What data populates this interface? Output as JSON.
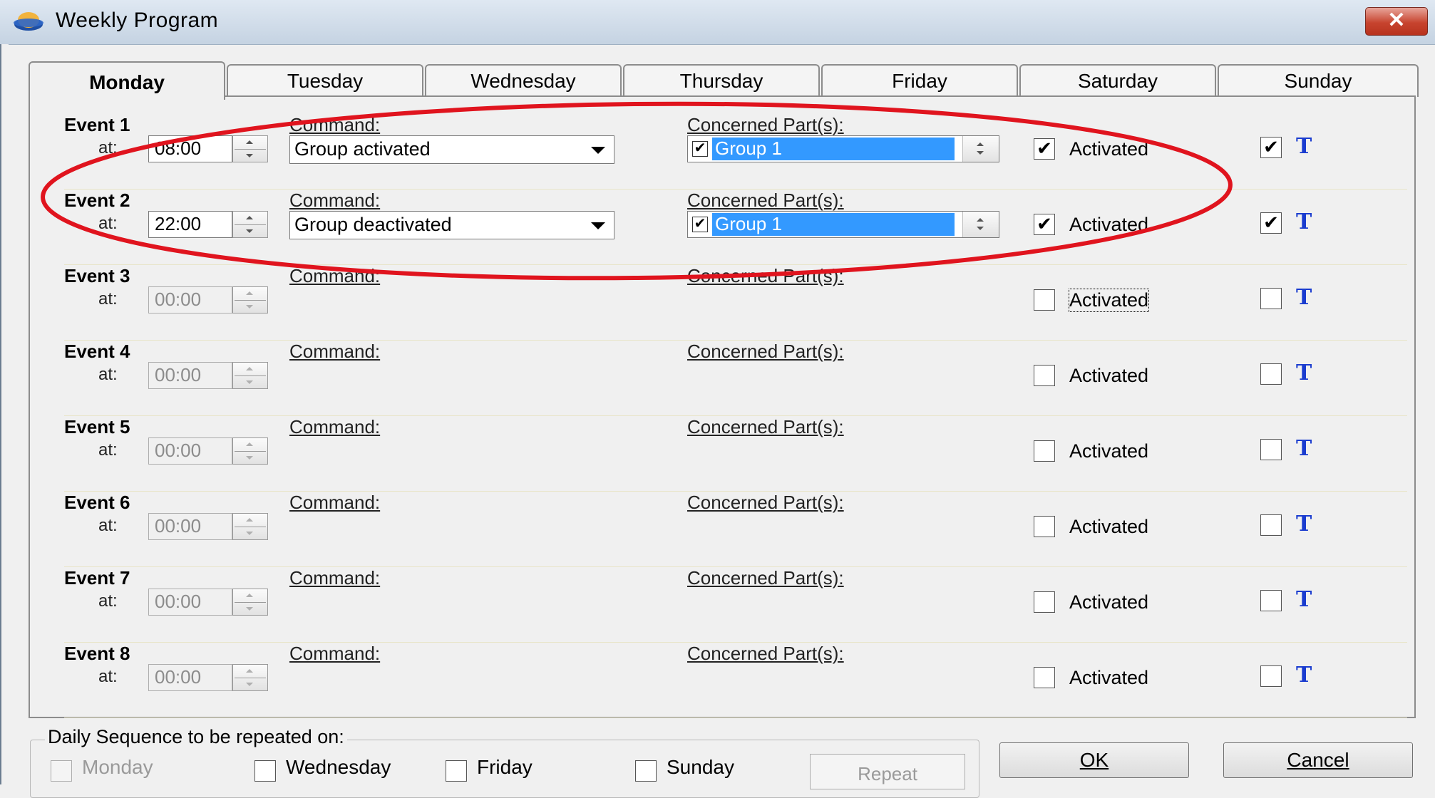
{
  "window": {
    "title": "Weekly Program",
    "close_glyph": "✕"
  },
  "tabs": [
    "Monday",
    "Tuesday",
    "Wednesday",
    "Thursday",
    "Friday",
    "Saturday",
    "Sunday"
  ],
  "active_tab": "Monday",
  "labels": {
    "at": "at:",
    "command": "Command:",
    "concerned_parts": "Concerned Part(s):",
    "activated": "Activated",
    "t": "T"
  },
  "events": [
    {
      "title": "Event 1",
      "time": "08:00",
      "enabled": true,
      "command": "Group activated",
      "part_checked": true,
      "part": "Group 1",
      "activated": true,
      "t": true
    },
    {
      "title": "Event 2",
      "time": "22:00",
      "enabled": true,
      "command": "Group deactivated",
      "part_checked": true,
      "part": "Group 1",
      "activated": true,
      "t": true
    },
    {
      "title": "Event 3",
      "time": "00:00",
      "enabled": false,
      "activated": false,
      "t": false
    },
    {
      "title": "Event 4",
      "time": "00:00",
      "enabled": false,
      "activated": false,
      "t": false
    },
    {
      "title": "Event 5",
      "time": "00:00",
      "enabled": false,
      "activated": false,
      "t": false
    },
    {
      "title": "Event 6",
      "time": "00:00",
      "enabled": false,
      "activated": false,
      "t": false
    },
    {
      "title": "Event 7",
      "time": "00:00",
      "enabled": false,
      "activated": false,
      "t": false
    },
    {
      "title": "Event 8",
      "time": "00:00",
      "enabled": false,
      "activated": false,
      "t": false
    }
  ],
  "daily_sequence": {
    "title": "Daily Sequence to be repeated on:",
    "days": [
      {
        "label": "Monday",
        "checked": false,
        "disabled": true
      },
      {
        "label": "Wednesday",
        "checked": false,
        "disabled": false
      },
      {
        "label": "Friday",
        "checked": false,
        "disabled": false
      },
      {
        "label": "Sunday",
        "checked": false,
        "disabled": false
      }
    ],
    "repeat_label": "Repeat"
  },
  "buttons": {
    "ok": "OK",
    "cancel": "Cancel"
  },
  "colors": {
    "selection": "#3399ff",
    "annotation_ellipse": "#e0141e",
    "t_glyph": "#1a3ccf"
  }
}
